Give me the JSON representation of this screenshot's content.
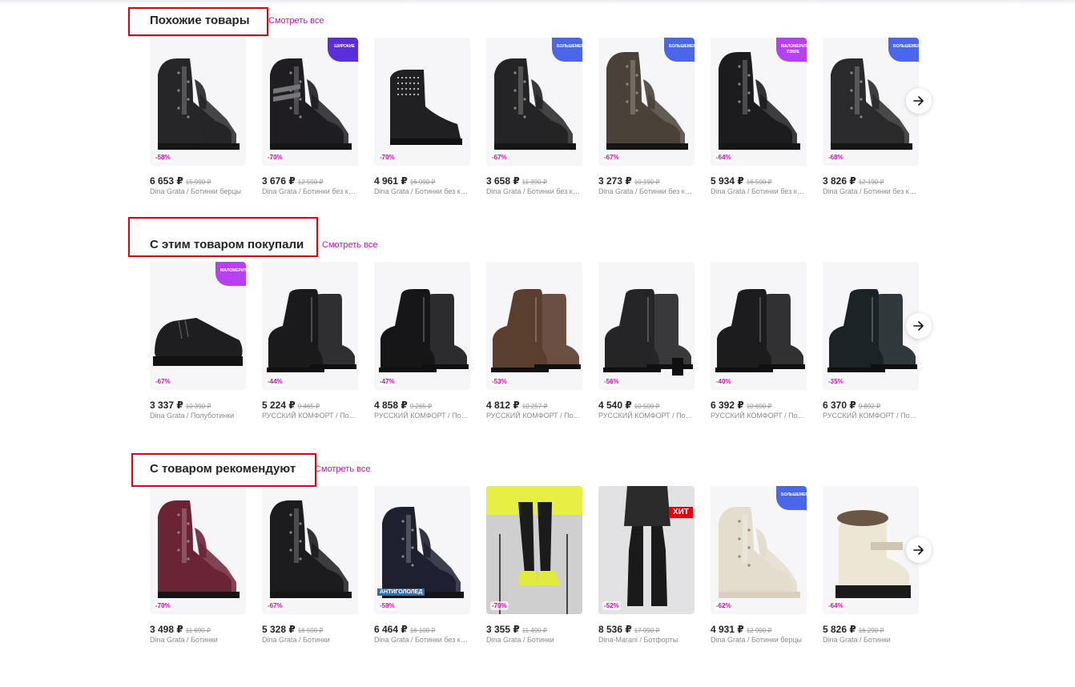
{
  "sections": [
    {
      "title": "Похожие товары",
      "see_all": "Смотреть все",
      "next_icon": "arrow-right-icon",
      "items": [
        {
          "price": "6 653 ₽",
          "old": "15 990 ₽",
          "name": "Dina Grata / Ботинки берцы",
          "discount": "-58%",
          "badge": "",
          "shoe": "boot-lace",
          "color": "#262628"
        },
        {
          "price": "3 676 ₽",
          "old": "12 590 ₽",
          "name": "Dina Grata / Ботинки без каблука",
          "discount": "-70%",
          "badge": "ШИРОКИЕ",
          "shoe": "boot-strap",
          "color": "#1f1d22"
        },
        {
          "price": "4 961 ₽",
          "old": "16 990 ₽",
          "name": "Dina Grata / Ботинки без каблука",
          "discount": "-70%",
          "badge": "",
          "shoe": "chelsea",
          "color": "#202022"
        },
        {
          "price": "3 658 ₽",
          "old": "11 390 ₽",
          "name": "Dina Grata / Ботинки без каблука",
          "discount": "-67%",
          "badge": "БОЛЬШЕМЕРИТ",
          "shoe": "boot-lace",
          "color": "#242426"
        },
        {
          "price": "3 273 ₽",
          "old": "10 190 ₽",
          "name": "Dina Grata / Ботинки без каблука",
          "discount": "-67%",
          "badge": "БОЛЬШЕМЕРИТ",
          "shoe": "boot-tall",
          "color": "#4a4238"
        },
        {
          "price": "5 934 ₽",
          "old": "16 590 ₽",
          "name": "Dina Grata / Ботинки без каблука",
          "discount": "-64%",
          "badge": "МАЛОМЕРИТ УЗКИЕ",
          "shoe": "boot-tall",
          "color": "#1c1c1e"
        },
        {
          "price": "3 826 ₽",
          "old": "12 190 ₽",
          "name": "Dina Grata / Ботинки без каблука",
          "discount": "-68%",
          "badge": "БОЛЬШЕМЕРИТ",
          "shoe": "boot-lace",
          "color": "#2a2a2c"
        }
      ]
    },
    {
      "title": "С этим товаром покупали",
      "see_all": "Смотреть все",
      "next_icon": "arrow-right-icon",
      "items": [
        {
          "price": "3 337 ₽",
          "old": "10 390 ₽",
          "name": "Dina Grata / Полуботинки",
          "discount": "-67%",
          "badge": "МАЛОМЕРИТ",
          "shoe": "low",
          "color": "#1e1e20"
        },
        {
          "price": "5 224 ₽",
          "old": "9 465 ₽",
          "name": "РУССКИЙ КОМФОРТ / Полусапоги",
          "discount": "-44%",
          "badge": "",
          "shoe": "ankle-zip",
          "color": "#1a1a1c"
        },
        {
          "price": "4 858 ₽",
          "old": "9 265 ₽",
          "name": "РУССКИЙ КОМФОРТ / Полусапоги",
          "discount": "-47%",
          "badge": "",
          "shoe": "ankle-zip",
          "color": "#161618"
        },
        {
          "price": "4 812 ₽",
          "old": "10 257 ₽",
          "name": "РУССКИЙ КОМФОРТ / Полусапоги",
          "discount": "-53%",
          "badge": "",
          "shoe": "ankle-zip",
          "color": "#5a3e2e"
        },
        {
          "price": "4 540 ₽",
          "old": "10 500 ₽",
          "name": "РУССКИЙ КОМФОРТ / Полусапоги",
          "discount": "-56%",
          "badge": "",
          "shoe": "ankle-heel",
          "color": "#252527"
        },
        {
          "price": "6 392 ₽",
          "old": "10 690 ₽",
          "name": "РУССКИЙ КОМФОРТ / Полусапоги",
          "discount": "-40%",
          "badge": "",
          "shoe": "ankle-zip",
          "color": "#1c1c1e"
        },
        {
          "price": "6 370 ₽",
          "old": "9 892 ₽",
          "name": "РУССКИЙ КОМФОРТ / Полусапоги",
          "discount": "-35%",
          "badge": "",
          "shoe": "ankle-zip",
          "color": "#1a2426"
        }
      ]
    },
    {
      "title": "С товаром рекомендуют",
      "see_all": "Смотреть все",
      "next_icon": "arrow-right-icon",
      "items": [
        {
          "price": "3 498 ₽",
          "old": "11 690 ₽",
          "name": "Dina Grata / Ботинки",
          "discount": "-70%",
          "badge": "",
          "shoe": "boot-tall",
          "color": "#6b2436"
        },
        {
          "price": "5 328 ₽",
          "old": "16 590 ₽",
          "name": "Dina Grata / Ботинки",
          "discount": "-67%",
          "badge": "",
          "shoe": "boot-tall",
          "color": "#1c1c1e"
        },
        {
          "price": "6 464 ₽",
          "old": "16 100 ₽",
          "name": "Dina Grata / Ботинки без каблука",
          "discount": "-59%",
          "badge": "",
          "shoe": "boot-lace",
          "color": "#1e2030",
          "overlay_text": "АНТИГОЛОЛЕД"
        },
        {
          "price": "3 355 ₽",
          "old": "11 490 ₽",
          "name": "Dina Grata / Ботинки",
          "discount": "-70%",
          "badge": "",
          "shoe": "photo-legs",
          "color": "#e7ef44"
        },
        {
          "price": "8 536 ₽",
          "old": "17 990 ₽",
          "name": "Dina-Marani / Ботфорты",
          "discount": "-52%",
          "badge": "ХИТ",
          "shoe": "photo-tall",
          "color": "#1a1a1a"
        },
        {
          "price": "4 931 ₽",
          "old": "12 990 ₽",
          "name": "Dina Grata / Ботинки берцы",
          "discount": "-62%",
          "badge": "БОЛЬШЕМЕРИТ",
          "shoe": "boot-lace",
          "color": "#e4dccd"
        },
        {
          "price": "5 826 ₽",
          "old": "16 290 ₽",
          "name": "Dina Grata / Ботинки",
          "discount": "-64%",
          "badge": "",
          "shoe": "fur",
          "color": "#ece6d4"
        }
      ]
    }
  ],
  "colors": {
    "accent": "#cb11ab",
    "highlight_box": "#e3000b"
  }
}
